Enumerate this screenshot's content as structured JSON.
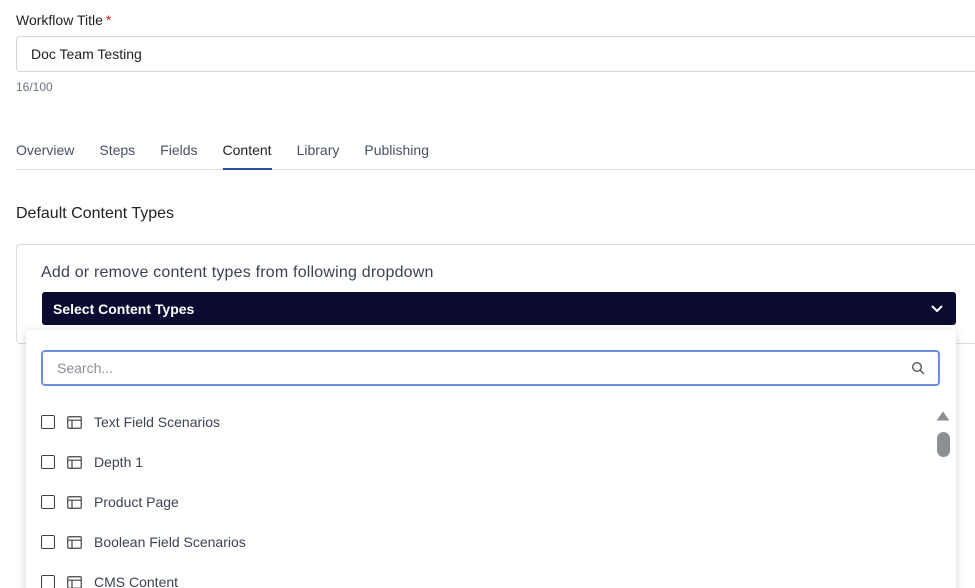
{
  "workflow": {
    "title_label": "Workflow Title",
    "required_mark": "*",
    "title_value": "Doc Team Testing",
    "char_count": "16/100"
  },
  "tabs": [
    {
      "label": "Overview",
      "active": false
    },
    {
      "label": "Steps",
      "active": false
    },
    {
      "label": "Fields",
      "active": false
    },
    {
      "label": "Content",
      "active": true
    },
    {
      "label": "Library",
      "active": false
    },
    {
      "label": "Publishing",
      "active": false
    }
  ],
  "content_types": {
    "section_title": "Default Content Types",
    "hint": "Add or remove content types from following dropdown",
    "select_label": "Select Content Types",
    "search_placeholder": "Search...",
    "items": [
      {
        "label": "Text Field Scenarios",
        "checked": false
      },
      {
        "label": "Depth 1",
        "checked": false
      },
      {
        "label": "Product Page",
        "checked": false
      },
      {
        "label": "Boolean Field Scenarios",
        "checked": false
      },
      {
        "label": "CMS Content",
        "checked": false
      }
    ]
  },
  "colors": {
    "accent": "#2b4c9b",
    "select_bar": "#0b0a30",
    "search_border": "#6c8fdb",
    "required": "#e02020"
  },
  "icons": {
    "chevron": "chevron-down-icon",
    "search": "search-icon",
    "content_type": "content-type-icon",
    "scroll_up": "scroll-up-arrow-icon"
  }
}
